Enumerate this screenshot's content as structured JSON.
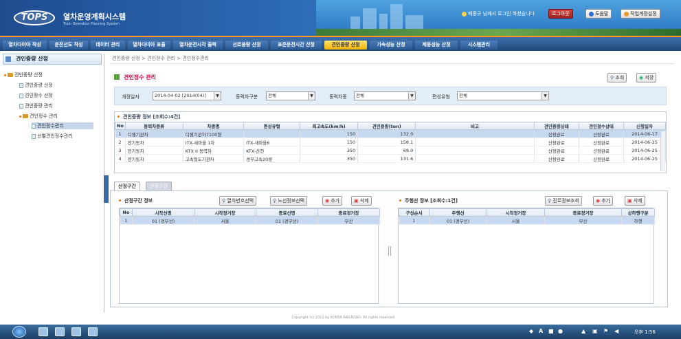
{
  "app": {
    "title": "열차운영계획시스템",
    "subtitle": "Train Operation Planning System",
    "logo": "TOPS"
  },
  "user": {
    "text": "배종규 님께서 로그인 하셨습니다"
  },
  "header_buttons": {
    "logout": "로그아웃",
    "help": "도움말",
    "settings": "작업계정설정"
  },
  "menu": [
    "열차다이아 작성",
    "운전선도 작성",
    "데이터 관리",
    "열차다이아 표출",
    "열차운전시각 출력",
    "선로용량 산정",
    "표준운전시간 산정",
    "견인중량 산정",
    "가속성능 산정",
    "제동성능 산정",
    "시스템관리"
  ],
  "menu_active_index": 7,
  "sidebar": {
    "header": "견인중량 산정",
    "items": [
      {
        "label": "견인중량 산정",
        "level": 0,
        "type": "folder"
      },
      {
        "label": "견인중량 산정",
        "level": 1,
        "type": "doc"
      },
      {
        "label": "견인정수 산정",
        "level": 1,
        "type": "doc"
      },
      {
        "label": "견인중량 관리",
        "level": 1,
        "type": "doc"
      },
      {
        "label": "견인정수 관리",
        "level": 1,
        "type": "folder"
      },
      {
        "label": "견인정수관리",
        "level": 2,
        "type": "doc",
        "selected": true
      },
      {
        "label": "선별견인정수관리",
        "level": 2,
        "type": "doc"
      }
    ]
  },
  "breadcrumb": "견인중량 산정 > 견인정수 관리 > 견인정수관리",
  "page_title": "견인정수 관리",
  "actions": {
    "search": "조회",
    "save": "저장"
  },
  "filters": {
    "date_label": "개정일자",
    "date_value": "2014-04-02 [2014(04)]",
    "vclass_label": "동력차구분",
    "vclass_value": "전체",
    "vehicle_label": "동력차종",
    "vehicle_value": "전체",
    "type_label": "편성유형",
    "type_value": "전체"
  },
  "top_panel": {
    "title": "견인중량 정보 [조회수:4건]",
    "columns": [
      "No",
      "동력차종류",
      "차종명",
      "편성유형",
      "최고속도(km/h)",
      "견인중량(ton)",
      "비고",
      "견인중량상태",
      "견인정수상태",
      "신청일자"
    ],
    "rows": [
      [
        "1",
        "디젤기관차",
        "디젤기관차7100형",
        "",
        "150",
        "132.0",
        "",
        "산정완료",
        "산정완료",
        "2014-06-17"
      ],
      [
        "2",
        "전기동차",
        "ITX-새마을 1차",
        "ITX-새마을6",
        "150",
        "158.1",
        "",
        "산정완료",
        "산정완료",
        "2014-06-25"
      ],
      [
        "3",
        "전기동차",
        "KTX II 동력차",
        "KTX-산천",
        "350",
        "68.0",
        "",
        "산정완료",
        "산정완료",
        "2014-06-25"
      ],
      [
        "4",
        "전기동차",
        "고속철도기관차",
        "경부고속20량",
        "350",
        "131.6",
        "",
        "산정완료",
        "산정완료",
        "2014-06-25"
      ]
    ],
    "selected_row": 0
  },
  "tabs": [
    "산정구간",
    "산정구간"
  ],
  "left_panel": {
    "title": "산정구간 정보",
    "buttons": {
      "b1": "열차번호선택",
      "b2": "노선정보선택",
      "add": "추가",
      "del": "삭제"
    },
    "columns": [
      "No",
      "시작선명",
      "시작정거장",
      "종료선명",
      "종료정거장"
    ],
    "rows": [
      [
        "1",
        "01 (경부선)",
        "서울",
        "01 (경부선)",
        "부산"
      ]
    ]
  },
  "right_panel": {
    "title": "주행선 정보 [조회수:1건]",
    "buttons": {
      "route": "진로정보조회",
      "add": "추가",
      "del": "삭제"
    },
    "columns": [
      "구성순서",
      "주행선",
      "시작정거장",
      "종료정거장",
      "상하행구분"
    ],
    "rows": [
      [
        "1",
        "01 (경부선)",
        "서울",
        "부산",
        "하행"
      ]
    ]
  },
  "footer": "Copyright (c) 2012 by KOREA RAILROAD. All rights reserved.",
  "taskbar": {
    "clock": "오후 1:56"
  }
}
